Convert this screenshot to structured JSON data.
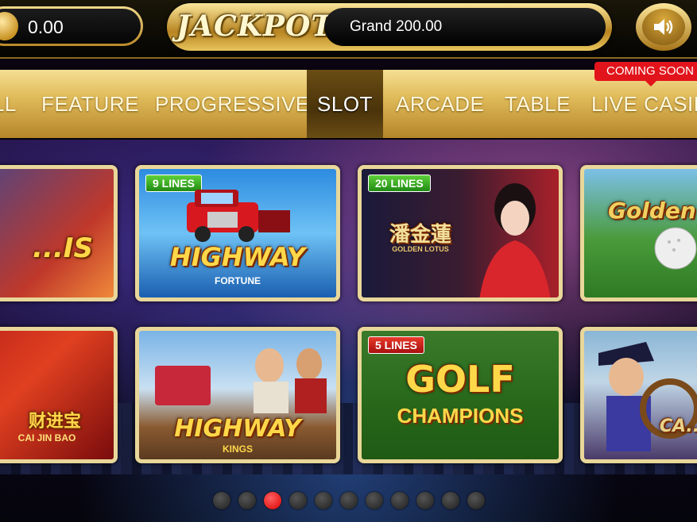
{
  "topbar": {
    "balance": "0.00",
    "jackpot_logo": "JACKPOT",
    "jackpot_value": "Grand 200.00"
  },
  "nav": {
    "tabs": [
      {
        "label": "ALL"
      },
      {
        "label": "FEATURE"
      },
      {
        "label": "PROGRESSIVE"
      },
      {
        "label": "SLOT"
      },
      {
        "label": "ARCADE"
      },
      {
        "label": "TABLE"
      },
      {
        "label": "LIVE CASINO"
      }
    ],
    "active_tab": "SLOT",
    "badge": "COMING SOON"
  },
  "games": [
    {
      "title": "...IS",
      "lines": ""
    },
    {
      "title": "HIGHWAY",
      "subtitle": "FORTUNE",
      "lines": "9 LINES"
    },
    {
      "title": "潘金蓮",
      "subtitle": "GOLDEN LOTUS",
      "lines": "20 LINES"
    },
    {
      "title": "Golden T...",
      "lines": ""
    },
    {
      "title": "财进宝",
      "subtitle": "CAI JIN BAO",
      "lines": ""
    },
    {
      "title": "HIGHWAY",
      "subtitle": "KINGS",
      "lines": ""
    },
    {
      "title": "GOLF",
      "subtitle": "CHAMPIONS",
      "lines": "5 LINES"
    },
    {
      "title": "CA... TRE...",
      "lines": ""
    }
  ],
  "pagination": {
    "total": 11,
    "active": 3
  },
  "colors": {
    "gold": "#e0bb5a",
    "active_tab": "#4a330a",
    "badge": "#e2141b"
  }
}
